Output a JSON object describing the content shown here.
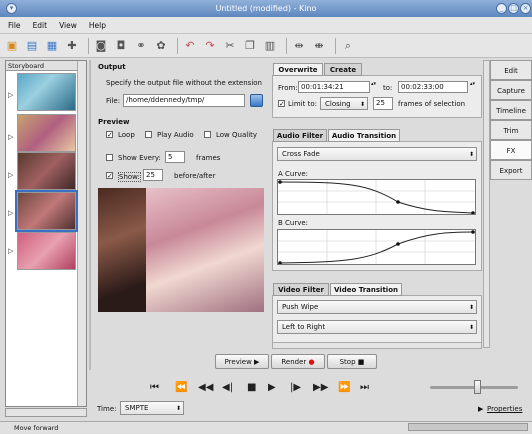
{
  "window": {
    "title": "Untitled (modified) - Kino"
  },
  "menu": {
    "items": [
      "File",
      "Edit",
      "View",
      "Help"
    ]
  },
  "storyboard": {
    "title": "Storyboard"
  },
  "output": {
    "heading": "Output",
    "description": "Specify the output file without the extension",
    "file_label": "File:",
    "file_value": "/home/ddennedy/tmp/"
  },
  "preview": {
    "heading": "Preview",
    "loop": "Loop",
    "play_audio": "Play Audio",
    "low_quality": "Low Quality",
    "show_every": "Show Every:",
    "show_every_value": "5",
    "frames": "frames",
    "show": "Show:",
    "show_value": "25",
    "before_after": "before/after"
  },
  "overwrite": {
    "tab1": "Overwrite",
    "tab2": "Create",
    "from": "From:",
    "from_value": "00:01:34:21",
    "to": "to:",
    "to_value": "00:02:33:00",
    "limit": "Limit to:",
    "limit_combo": "Closing",
    "limit_value": "25",
    "limit_suffix": "frames of selection"
  },
  "audio": {
    "tab1": "Audio Filter",
    "tab2": "Audio Transition",
    "transition": "Cross Fade",
    "a_curve": "A Curve:",
    "b_curve": "B Curve:"
  },
  "video": {
    "tab1": "Video Filter",
    "tab2": "Video Transition",
    "transition": "Push Wipe",
    "direction": "Left to Right"
  },
  "actions": {
    "preview": "Preview",
    "render": "Render",
    "stop": "Stop"
  },
  "sidetabs": [
    "Edit",
    "Capture",
    "Timeline",
    "Trim",
    "FX",
    "Export"
  ],
  "time": {
    "label": "Time:",
    "value": "SMPTE"
  },
  "properties": "Properties",
  "status": "Move forward",
  "colors": {
    "titlebar": "#5f87c0",
    "render_dot": "#e01010",
    "selected_thumb": "#3b6fc4"
  }
}
